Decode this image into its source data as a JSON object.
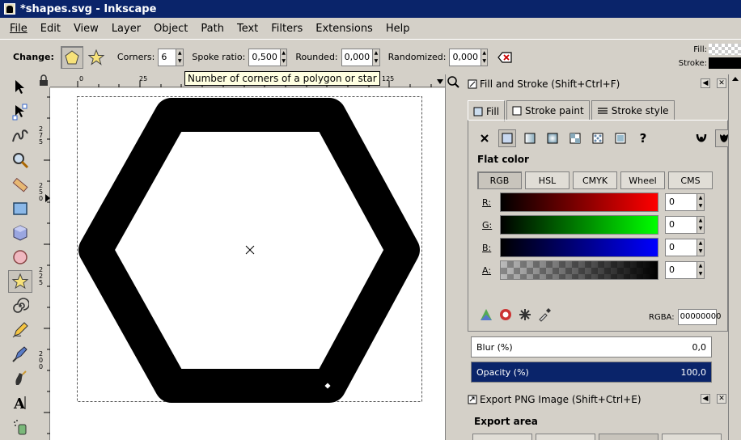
{
  "window": {
    "title": "*shapes.svg - Inkscape"
  },
  "menu": [
    {
      "label": "File"
    },
    {
      "label": "Edit"
    },
    {
      "label": "View"
    },
    {
      "label": "Layer"
    },
    {
      "label": "Object"
    },
    {
      "label": "Path"
    },
    {
      "label": "Text"
    },
    {
      "label": "Filters"
    },
    {
      "label": "Extensions"
    },
    {
      "label": "Help"
    }
  ],
  "controls": {
    "change_label": "Change:",
    "corners_label": "Corners:",
    "corners_value": "6",
    "spoke_label": "Spoke ratio:",
    "spoke_value": "0,500",
    "rounded_label": "Rounded:",
    "rounded_value": "0,000",
    "randomized_label": "Randomized:",
    "randomized_value": "0,000",
    "fill_label": "Fill:",
    "stroke_label": "Stroke:"
  },
  "tooltip": "Number of corners of a polygon or star",
  "ruler": {
    "h_ticks": [
      "0",
      "25",
      "125"
    ],
    "v_ticks": [
      "2\n7\n5",
      "2\n5\n0",
      "2\n2\n5",
      "2\n0\n0"
    ]
  },
  "fill_stroke_panel": {
    "title": "Fill and Stroke (Shift+Ctrl+F)",
    "tabs": [
      {
        "label": "Fill"
      },
      {
        "label": "Stroke paint"
      },
      {
        "label": "Stroke style"
      }
    ],
    "flat_color_heading": "Flat color",
    "modes": [
      {
        "label": "RGB"
      },
      {
        "label": "HSL"
      },
      {
        "label": "CMYK"
      },
      {
        "label": "Wheel"
      },
      {
        "label": "CMS"
      }
    ],
    "channels": [
      {
        "label": "R:",
        "value": "0"
      },
      {
        "label": "G:",
        "value": "0"
      },
      {
        "label": "B:",
        "value": "0"
      },
      {
        "label": "A:",
        "value": "0"
      }
    ],
    "rgba_label": "RGBA:",
    "rgba_value": "00000000",
    "blur_label": "Blur (%)",
    "blur_value": "0,0",
    "opacity_label": "Opacity (%)",
    "opacity_value": "100,0"
  },
  "export_panel": {
    "title": "Export PNG Image (Shift+Ctrl+E)",
    "export_area_heading": "Export area"
  },
  "colors": {
    "title_bar": "#0a246a",
    "selection": "#0a246a",
    "shape": "#000000"
  }
}
